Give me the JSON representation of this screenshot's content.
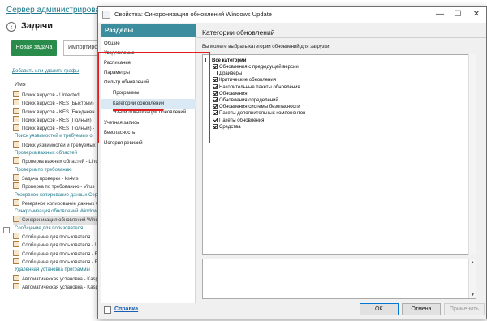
{
  "console": {
    "title": "Сервер администрирования K",
    "heading": "Задачи",
    "new_task": "Новая задача",
    "import": "Импортиров",
    "add_filter": "Добавить или удалить графы",
    "column_name": "Имя",
    "rows": [
      {
        "text": "Поиск вирусов - ! Infected",
        "kind": "task"
      },
      {
        "text": "Поиск вирусов - KES (Быстрый)",
        "kind": "task"
      },
      {
        "text": "Поиск вирусов - KES (Ежедневн",
        "kind": "task"
      },
      {
        "text": "Поиск вирусов - KES (Полный)",
        "kind": "task"
      },
      {
        "text": "Поиск вирусов - KES (Полный) -",
        "kind": "task"
      },
      {
        "text": "Поиск уязвимостей и требуемых о",
        "kind": "group"
      },
      {
        "text": "Поиск уязвимостей и требуемых о",
        "kind": "task"
      },
      {
        "text": "Проверка важных областей",
        "kind": "group"
      },
      {
        "text": "Проверка важных областей - Linu",
        "kind": "task"
      },
      {
        "text": "Проверка по требованию",
        "kind": "group"
      },
      {
        "text": "Задача проверки - ks4ws",
        "kind": "task"
      },
      {
        "text": "Проверка по требованию - Virus",
        "kind": "task"
      },
      {
        "text": "Резервное копирование данных Серв",
        "kind": "group"
      },
      {
        "text": "Резервное копирование данных С",
        "kind": "task"
      },
      {
        "text": "Синхронизация обновлений Windows",
        "kind": "group"
      },
      {
        "text": "Синхронизация обновлений Wind",
        "kind": "task",
        "selected": true
      },
      {
        "text": "Сообщение для пользователя",
        "kind": "group"
      },
      {
        "text": "Сообщение для пользователя",
        "kind": "task"
      },
      {
        "text": "Сообщение для пользователя - !",
        "kind": "task"
      },
      {
        "text": "Сообщение для пользователя - В",
        "kind": "task"
      },
      {
        "text": "Сообщение для пользователя - В",
        "kind": "task"
      },
      {
        "text": "Удаленная установка программы",
        "kind": "group"
      },
      {
        "text": "Автоматическая установка - Kaspe",
        "kind": "task"
      },
      {
        "text": "Автоматическая установка - Kasp",
        "kind": "task"
      }
    ]
  },
  "dialog": {
    "title": "Свойства: Синхронизация обновлений Windows Update",
    "sections_header": "Разделы",
    "nav": [
      {
        "label": "Общие"
      },
      {
        "label": "Уведомление"
      },
      {
        "label": "Расписание"
      },
      {
        "label": "Параметры"
      },
      {
        "label": "Фильтр обновлений"
      },
      {
        "label": "Программы",
        "sub": true
      },
      {
        "label": "Категории обновлений",
        "sub": true,
        "selected": true
      },
      {
        "label": "Языки локализации обновлений",
        "sub": true
      },
      {
        "label": "Учетная запись"
      },
      {
        "label": "Безопасность"
      },
      {
        "label": "История ревизий"
      }
    ],
    "panel_title": "Категории обновлений",
    "description": "Вы можете выбрать категории обновлений для загрузки.",
    "all_categories": "Все категории",
    "categories": [
      {
        "label": "Обновления с предыдущей версии",
        "checked": true
      },
      {
        "label": "Драйверы",
        "checked": false
      },
      {
        "label": "Критические обновления",
        "checked": true
      },
      {
        "label": "Накопительные пакеты обновления",
        "checked": true
      },
      {
        "label": "Обновления",
        "checked": true
      },
      {
        "label": "Обновления определений",
        "checked": true
      },
      {
        "label": "Обновления системы безопасности",
        "checked": true
      },
      {
        "label": "Пакеты дополнительных компонентов",
        "checked": true
      },
      {
        "label": "Пакеты обновления",
        "checked": true
      },
      {
        "label": "Средства",
        "checked": true
      }
    ],
    "help": "Справка",
    "ok": "OK",
    "cancel": "Отмена",
    "apply": "Применить",
    "highlight_color": "#e02020",
    "accent_color": "#3c8e9e"
  }
}
